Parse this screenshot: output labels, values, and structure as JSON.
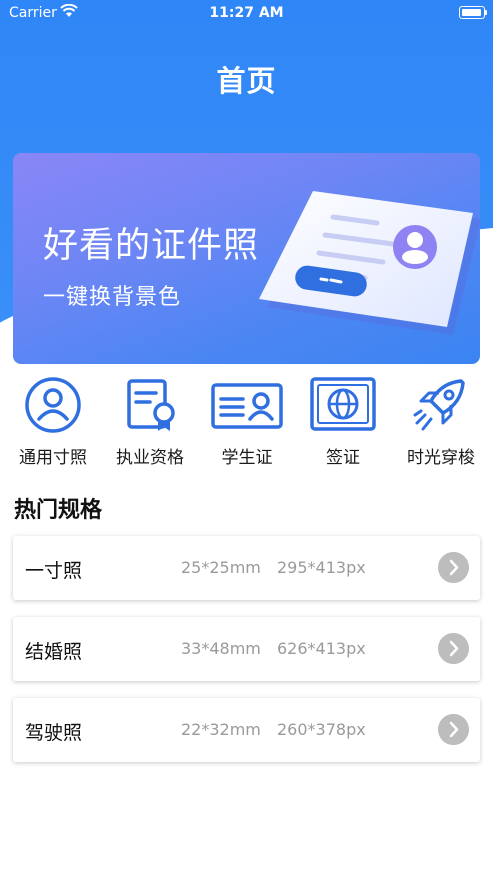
{
  "status_bar": {
    "carrier": "Carrier",
    "time": "11:27 AM"
  },
  "page": {
    "title": "首页"
  },
  "banner": {
    "title": "好看的证件照",
    "subtitle": "一键换背景色"
  },
  "categories": [
    {
      "label": "通用寸照",
      "icon": "person-circle-icon"
    },
    {
      "label": "执业资格",
      "icon": "certificate-icon"
    },
    {
      "label": "学生证",
      "icon": "id-card-icon"
    },
    {
      "label": "签证",
      "icon": "passport-globe-icon"
    },
    {
      "label": "时光穿梭",
      "icon": "rocket-icon"
    }
  ],
  "hot_specs": {
    "title": "热门规格",
    "items": [
      {
        "name": "一寸照",
        "size": "25*25mm",
        "pixels": "295*413px"
      },
      {
        "name": "结婚照",
        "size": "33*48mm",
        "pixels": "626*413px"
      },
      {
        "name": "驾驶照",
        "size": "22*32mm",
        "pixels": "260*378px"
      }
    ]
  },
  "colors": {
    "primary": "#3a8ff8",
    "icon_blue": "#2f6fe0",
    "text_dark": "#111111",
    "text_muted": "#9a9a9a",
    "arrow_gray": "#bdbdbd"
  }
}
